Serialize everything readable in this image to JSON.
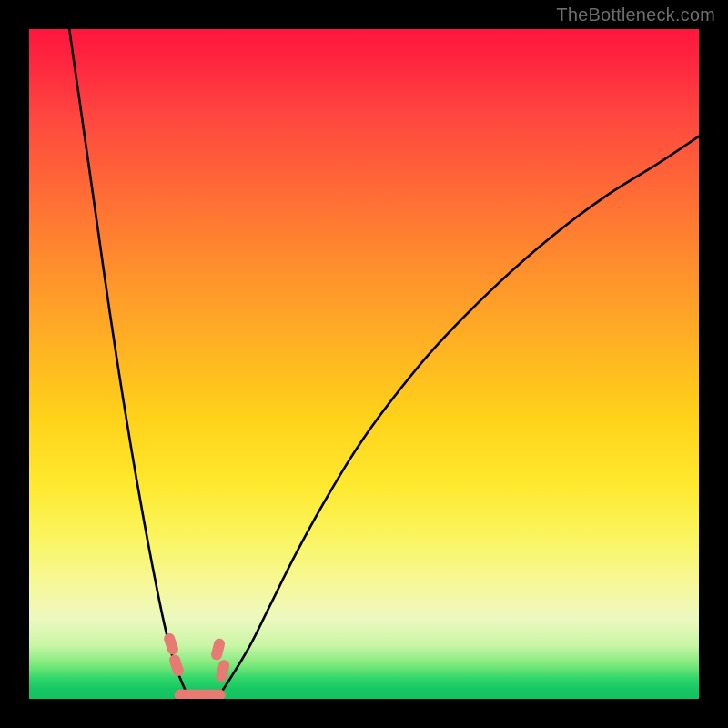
{
  "watermark": "TheBottleneck.com",
  "colors": {
    "frame": "#000000",
    "curve": "#000000",
    "marker_fill": "#e77a72",
    "marker_stroke": "#c95850",
    "gradient_stops": [
      "#ff163e",
      "#ff2a3f",
      "#ff4a3f",
      "#ff6a36",
      "#ff8a2e",
      "#ffae24",
      "#ffd21a",
      "#ffe92e",
      "#faf560",
      "#f6f89a",
      "#edf8c0",
      "#c9f6a6",
      "#7ae87a",
      "#2fd66a",
      "#16c862",
      "#12c260"
    ]
  },
  "chart_data": {
    "type": "line",
    "title": "",
    "xlabel": "",
    "ylabel": "",
    "xlim": [
      0,
      100
    ],
    "ylim": [
      0,
      100
    ],
    "grid": false,
    "legend": false,
    "series": [
      {
        "name": "left-branch",
        "x": [
          6,
          8,
          10,
          12,
          14,
          16,
          18,
          20,
          21.5,
          23,
          24
        ],
        "values": [
          100,
          86,
          72,
          58,
          45,
          33,
          22,
          12,
          6,
          2,
          0
        ]
      },
      {
        "name": "right-branch",
        "x": [
          28,
          30,
          33,
          36,
          40,
          45,
          50,
          56,
          62,
          70,
          78,
          86,
          94,
          100
        ],
        "values": [
          0,
          3,
          8,
          14,
          22,
          31,
          39,
          47,
          54,
          62,
          69,
          75,
          80,
          84
        ]
      }
    ],
    "annotations": {
      "markers": [
        {
          "name": "left-top",
          "x": 21.2,
          "y": 8.2
        },
        {
          "name": "left-bottom",
          "x": 22.0,
          "y": 5.0
        },
        {
          "name": "right-top",
          "x": 28.2,
          "y": 7.4
        },
        {
          "name": "right-bottom",
          "x": 28.9,
          "y": 4.2
        }
      ],
      "floor_segment": {
        "x0": 22.5,
        "y0": 0.6,
        "x1": 28.5,
        "y1": 0.6
      }
    }
  }
}
